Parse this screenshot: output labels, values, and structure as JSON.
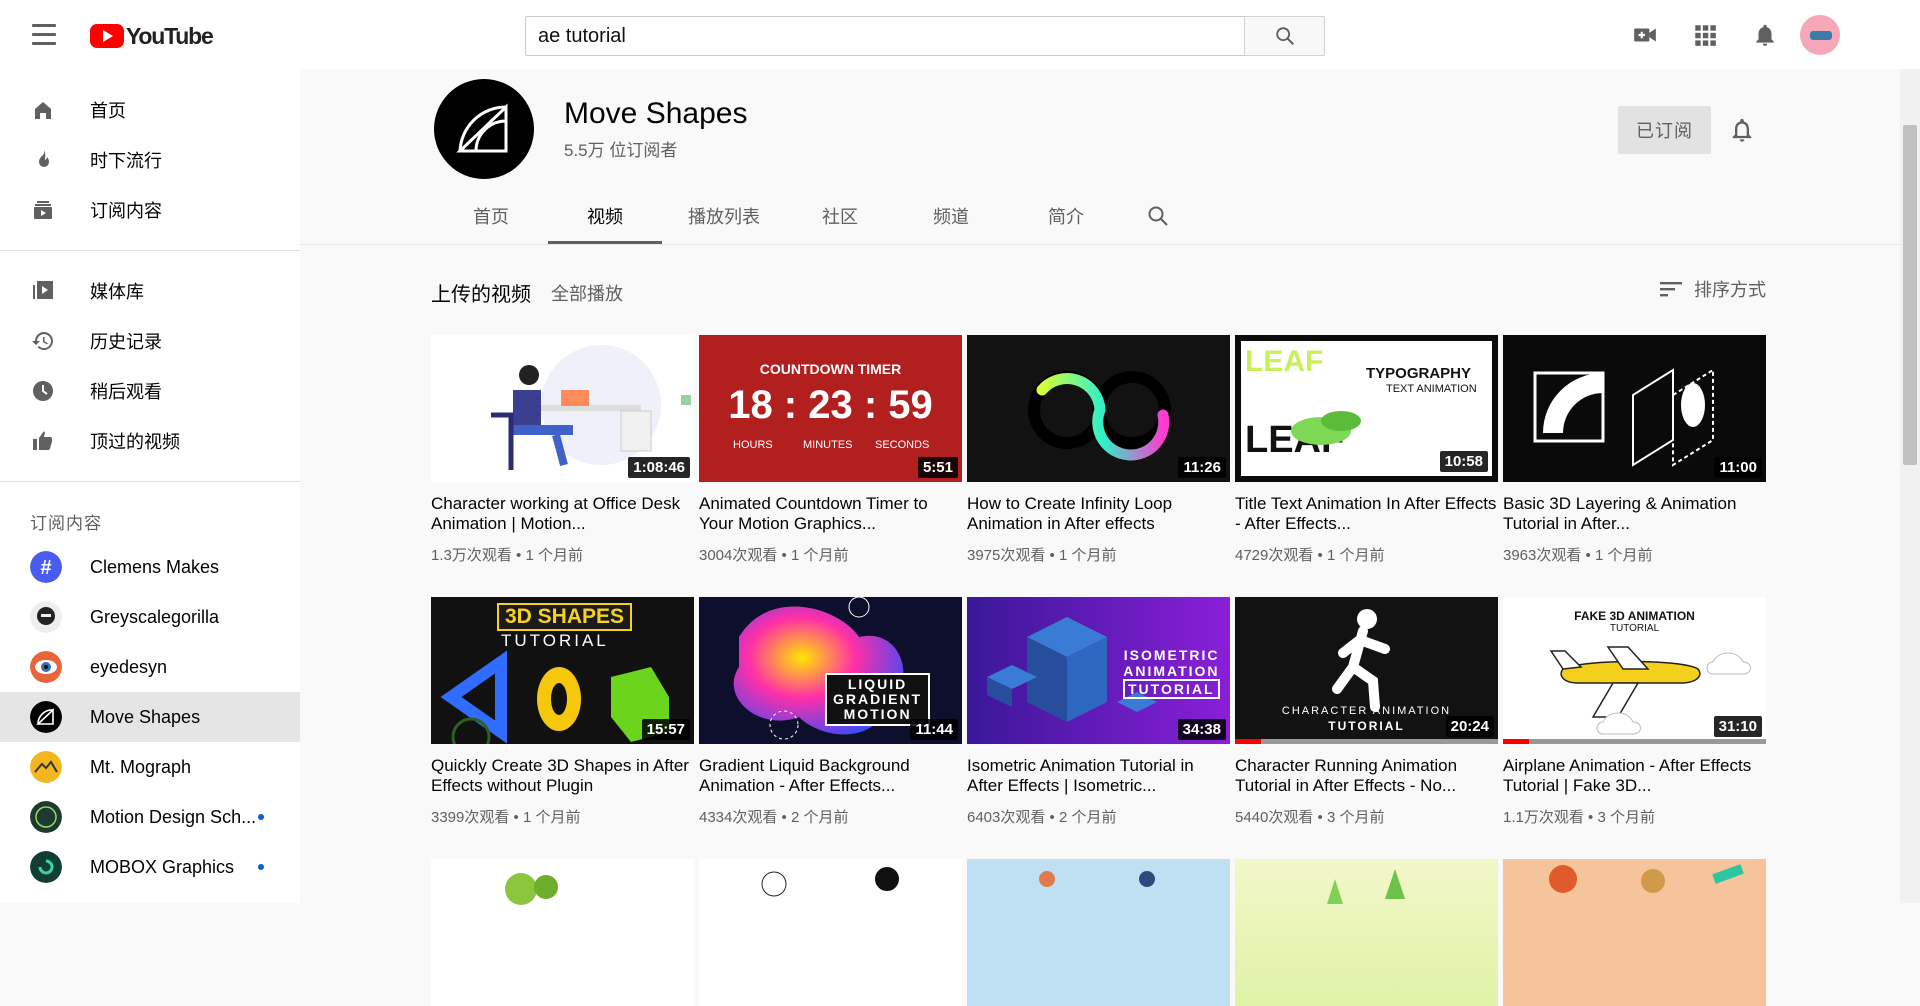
{
  "app": {
    "logo_text": "YouTube",
    "brand_color": "#ff0000"
  },
  "search": {
    "value": "ae tutorial"
  },
  "sidebar": {
    "main": [
      {
        "label": "首页",
        "icon": "home-icon"
      },
      {
        "label": "时下流行",
        "icon": "trending-icon"
      },
      {
        "label": "订阅内容",
        "icon": "subscriptions-icon"
      }
    ],
    "library": [
      {
        "label": "媒体库",
        "icon": "library-icon"
      },
      {
        "label": "历史记录",
        "icon": "history-icon"
      },
      {
        "label": "稍后观看",
        "icon": "watch-later-icon"
      },
      {
        "label": "顶过的视频",
        "icon": "liked-videos-icon"
      }
    ],
    "subscriptions_heading": "订阅内容",
    "subscriptions": [
      {
        "label": "Clemens Makes",
        "color": "#4a5cf0",
        "new": false
      },
      {
        "label": "Greyscalegorilla",
        "color": "#eeeeee",
        "new": false
      },
      {
        "label": "eyedesyn",
        "color": "#e8643a",
        "new": false
      },
      {
        "label": "Move Shapes",
        "color": "#000000",
        "new": false,
        "active": true
      },
      {
        "label": "Mt. Mograph",
        "color": "#f3b61f",
        "new": false
      },
      {
        "label": "Motion Design Sch...",
        "color": "#1d3b2c",
        "new": true
      },
      {
        "label": "MOBOX Graphics",
        "color": "#123d33",
        "new": true
      }
    ]
  },
  "channel": {
    "name": "Move Shapes",
    "subscribers": "5.5万 位订阅者",
    "subscribed_label": "已订阅",
    "tabs": [
      "首页",
      "视频",
      "播放列表",
      "社区",
      "频道",
      "简介"
    ],
    "active_tab": "视频"
  },
  "videos_section": {
    "title": "上传的视频",
    "play_all": "全部播放",
    "sort_label": "排序方式"
  },
  "videos": [
    {
      "title": "Character working at Office Desk Animation | Motion...",
      "meta": "1.3万次观看 • 1 个月前",
      "duration": "1:08:46"
    },
    {
      "title": "Animated Countdown Timer to Your Motion Graphics...",
      "meta": "3004次观看 • 1 个月前",
      "duration": "5:51",
      "thumb_text": {
        "heading": "COUNTDOWN TIMER",
        "time": "18 : 23 : 59",
        "units": [
          "HOURS",
          "MINUTES",
          "SECONDS"
        ]
      }
    },
    {
      "title": "How to Create Infinity Loop Animation in After effects",
      "meta": "3975次观看 • 1 个月前",
      "duration": "11:26"
    },
    {
      "title": "Title Text Animation In After Effects - After Effects...",
      "meta": "4729次观看 • 1 个月前",
      "duration": "10:58",
      "thumb_text": {
        "line1": "TYPOGRAPHY",
        "line2": "TEXT ANIMATION",
        "big1": "LEAF",
        "big2": "LEAF"
      }
    },
    {
      "title": "Basic 3D Layering & Animation Tutorial in After...",
      "meta": "3963次观看 • 1 个月前",
      "duration": "11:00"
    },
    {
      "title": "Quickly Create 3D Shapes in After Effects without Plugin",
      "meta": "3399次观看 • 1 个月前",
      "duration": "15:57",
      "thumb_text": {
        "line1": "3D SHAPES",
        "line2": "TUTORIAL"
      }
    },
    {
      "title": "Gradient Liquid Background Animation - After Effects...",
      "meta": "4334次观看 • 2 个月前",
      "duration": "11:44",
      "thumb_text": {
        "line1": "LIQUID",
        "line2": "GRADIENT",
        "line3": "MOTION"
      }
    },
    {
      "title": "Isometric Animation Tutorial in After Effects | Isometric...",
      "meta": "6403次观看 • 2 个月前",
      "duration": "34:38",
      "thumb_text": {
        "line1": "ISOMETRIC",
        "line2": "ANIMATION",
        "line3": "TUTORIAL"
      }
    },
    {
      "title": "Character Running Animation Tutorial in After Effects - No...",
      "meta": "5440次观看 • 3 个月前",
      "duration": "20:24",
      "progress": 0.1,
      "thumb_text": {
        "line1": "CHARACTER ANIMATION",
        "line2": "TUTORIAL"
      }
    },
    {
      "title": "Airplane Animation - After Effects Tutorial | Fake 3D...",
      "meta": "1.1万次观看 • 3 个月前",
      "duration": "31:10",
      "progress": 0.1,
      "thumb_text": {
        "line1": "FAKE 3D ANIMATION",
        "line2": "TUTORIAL"
      }
    }
  ]
}
